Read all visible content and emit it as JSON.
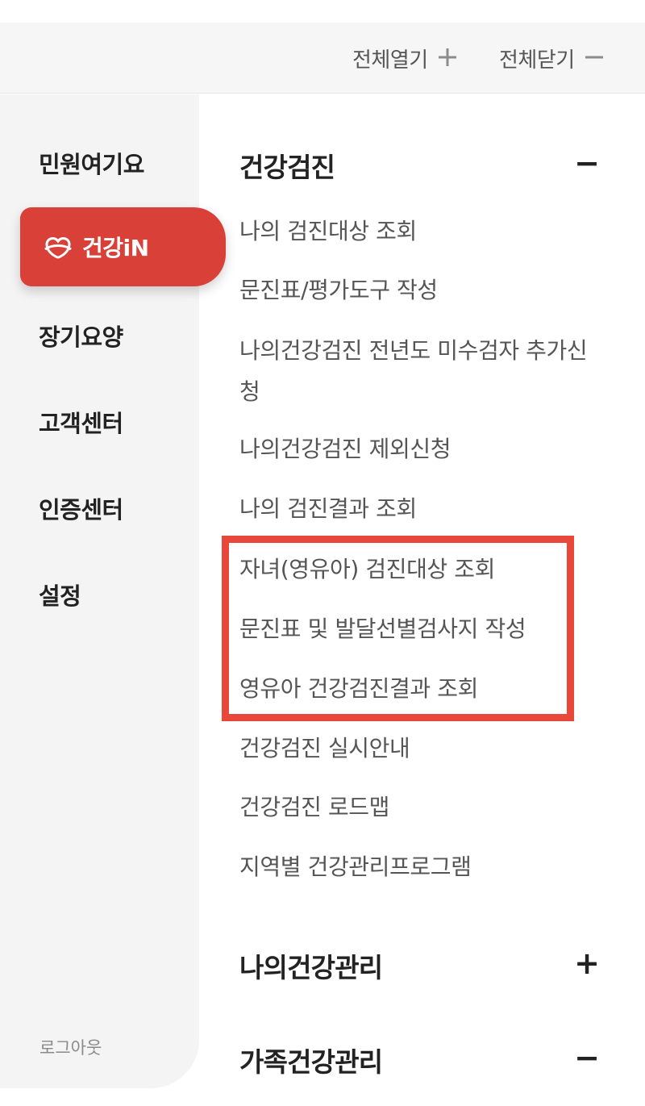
{
  "toolbar": {
    "expand_all": "전체열기",
    "collapse_all": "전체닫기",
    "expand_icon": "plus-icon",
    "collapse_icon": "minus-icon"
  },
  "sidebar": {
    "items": [
      {
        "label": "민원여기요"
      },
      {
        "label": "건강iN",
        "active": true,
        "icon": "health-in-logo-icon"
      },
      {
        "label": "장기요양"
      },
      {
        "label": "고객센터"
      },
      {
        "label": "인증센터"
      },
      {
        "label": "설정"
      }
    ],
    "logout": "로그아웃",
    "active_color": "#d84038"
  },
  "sections": [
    {
      "title": "건강검진",
      "toggle": "−",
      "expanded": true,
      "items": [
        "나의 검진대상 조회",
        "문진표/평가도구 작성",
        "나의건강검진 전년도 미수검자 추가신청",
        "나의건강검진 제외신청",
        "나의 검진결과 조회",
        "자녀(영유아) 검진대상 조회",
        "문진표 및 발달선별검사지 작성",
        "영유아 건강검진결과 조회",
        "건강검진 실시안내",
        "건강검진 로드맵",
        "지역별 건강관리프로그램"
      ]
    },
    {
      "title": "나의건강관리",
      "toggle": "+",
      "expanded": false
    },
    {
      "title": "가족건강관리",
      "toggle": "−",
      "expanded": true
    }
  ],
  "highlight": {
    "color": "#e8483a",
    "items": [
      "자녀(영유아) 검진대상 조회",
      "문진표 및 발달선별검사지 작성",
      "영유아 건강검진결과 조회"
    ]
  }
}
